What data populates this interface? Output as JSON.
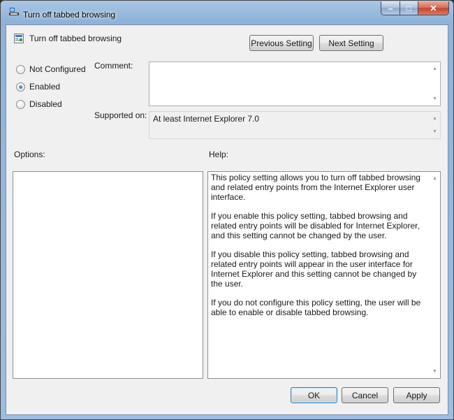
{
  "window": {
    "title": "Turn off tabbed browsing",
    "controls": {
      "minimize": "–",
      "maximize": "□",
      "close": "✕"
    }
  },
  "policy": {
    "name": "Turn off tabbed browsing"
  },
  "nav": {
    "previous": "Previous Setting",
    "next": "Next Setting"
  },
  "state": {
    "options": [
      {
        "label": "Not Configured",
        "checked": false
      },
      {
        "label": "Enabled",
        "checked": true
      },
      {
        "label": "Disabled",
        "checked": false
      }
    ]
  },
  "comment": {
    "label": "Comment:",
    "value": ""
  },
  "supported": {
    "label": "Supported on:",
    "value": "At least Internet Explorer 7.0"
  },
  "options_panel": {
    "label": "Options:"
  },
  "help_panel": {
    "label": "Help:",
    "paragraphs": [
      "This policy setting allows you to turn off tabbed browsing and related entry points from the Internet Explorer user interface.",
      "If you enable this policy setting, tabbed browsing and related entry points will be disabled for Internet Explorer, and this setting cannot be changed by the user.",
      "If you disable this policy setting, tabbed browsing and related entry points will appear in the user interface for Internet Explorer and this setting cannot be changed by the user.",
      "If you do not configure this policy setting, the user will be able to enable or disable tabbed browsing."
    ]
  },
  "footer": {
    "ok": "OK",
    "cancel": "Cancel",
    "apply": "Apply"
  },
  "icons": {
    "app": "group-policy-icon",
    "policy": "policy-setting-icon",
    "scroll_up": "▲",
    "scroll_down": "▼"
  }
}
